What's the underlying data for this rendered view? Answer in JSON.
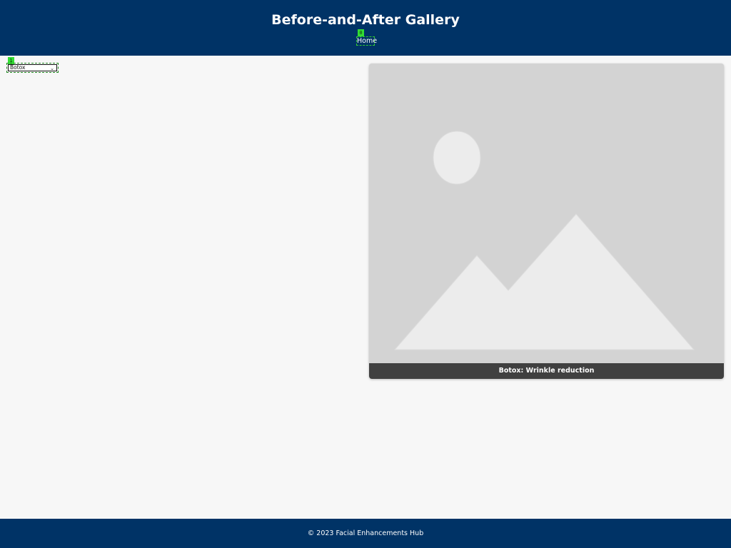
{
  "header": {
    "title": "Before-and-After Gallery",
    "nav": [
      {
        "label": "Home"
      }
    ]
  },
  "som_badges": [
    "0",
    "1"
  ],
  "filter": {
    "selected": "Botox",
    "chevron_icon": "chevron-down-icon"
  },
  "gallery": {
    "items": [
      {
        "caption": "Botox: Wrinkle reduction",
        "image_icon": "image-placeholder-icon"
      }
    ]
  },
  "footer": {
    "text": "© 2023 Facial Enhancements Hub"
  },
  "colors": {
    "brand": "#003366",
    "background": "#f7f7f7",
    "caption_bar": "#404040",
    "placeholder": "#d3d3d3",
    "highlight": "#33dd33"
  }
}
